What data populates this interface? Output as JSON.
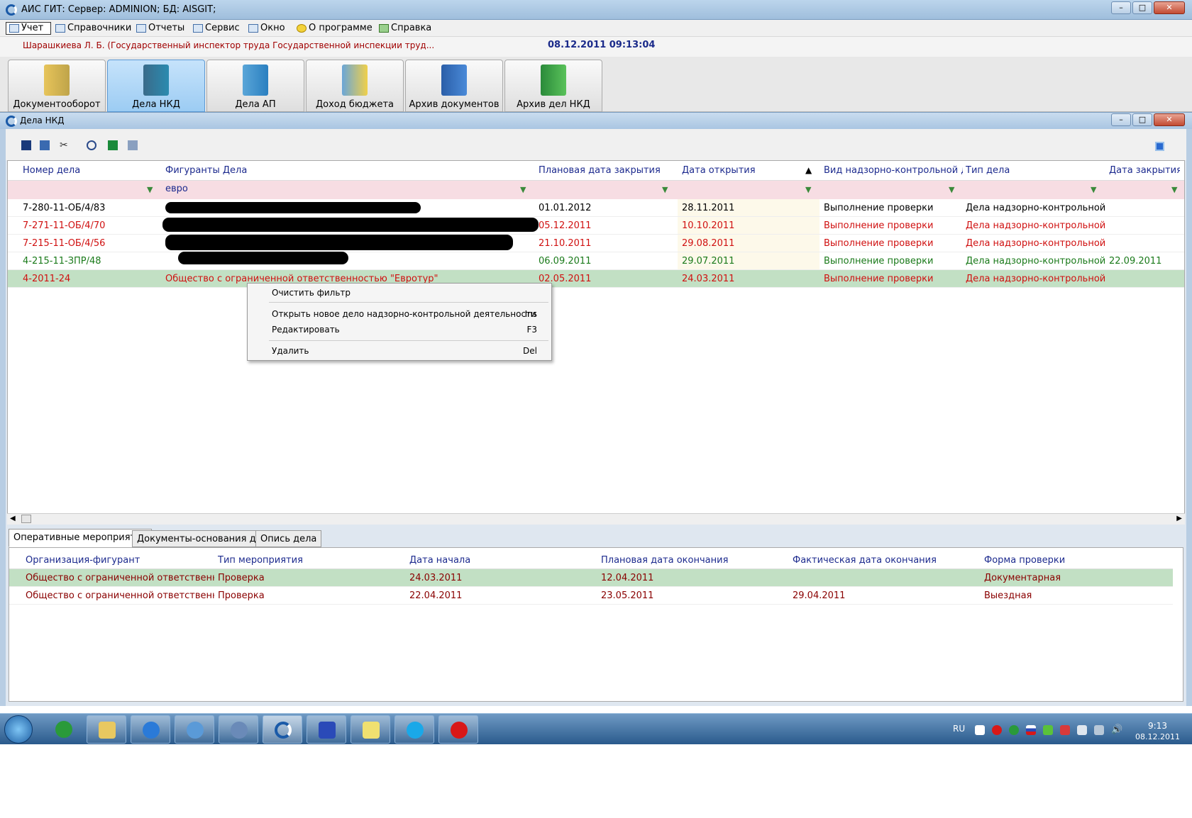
{
  "app": {
    "title": "АИС ГИТ:  Сервер: ADMINION;   БД: AISGIT;"
  },
  "menu": [
    {
      "label": "Учет"
    },
    {
      "label": "Справочники"
    },
    {
      "label": "Отчеты"
    },
    {
      "label": "Сервис"
    },
    {
      "label": "Окно"
    },
    {
      "label": "О программе"
    },
    {
      "label": "Справка"
    }
  ],
  "user": {
    "name": "Шарашкиева Л. Б. (Государственный инспектор труда Государственной инспекции труд...",
    "datetime": "08.12.2011  09:13:04"
  },
  "modules": [
    {
      "label": "Документооборот"
    },
    {
      "label": "Дела НКД"
    },
    {
      "label": "Дела АП"
    },
    {
      "label": "Доход бюджета"
    },
    {
      "label": "Архив документов"
    },
    {
      "label": "Архив дел НКД"
    }
  ],
  "child": {
    "title": "Дела НКД"
  },
  "grid": {
    "columns": [
      "Номер дела",
      "Фигуранты Дела",
      "Плановая дата закрытия",
      "Дата открытия",
      "Вид надзорно-контрольной деятельности",
      "Тип дела",
      "Дата закрытия"
    ],
    "filter": {
      "figuranty": "евро"
    },
    "rows": [
      {
        "num": "7-280-11-ОБ/4/83",
        "fig": "",
        "plan": "01.01.2012",
        "open": "28.11.2011",
        "vid": "Выполнение проверки",
        "tip": "Дела надзорно-контрольной де",
        "close": ""
      },
      {
        "num": "7-271-11-ОБ/4/70",
        "fig": "",
        "plan": "05.12.2011",
        "open": "10.10.2011",
        "vid": "Выполнение проверки",
        "tip": "Дела надзорно-контрольной де",
        "close": ""
      },
      {
        "num": "7-215-11-ОБ/4/56",
        "fig": "",
        "plan": "21.10.2011",
        "open": "29.08.2011",
        "vid": "Выполнение проверки",
        "tip": "Дела надзорно-контрольной де",
        "close": ""
      },
      {
        "num": "4-215-11-ЗПР/48",
        "fig": "",
        "plan": "06.09.2011",
        "open": "29.07.2011",
        "vid": "Выполнение проверки",
        "tip": "Дела надзорно-контрольной де",
        "close": "22.09.2011"
      },
      {
        "num": "4-2011-24",
        "fig": "Общество с ограниченной ответственностью \"Евротур\"",
        "plan": "02.05.2011",
        "open": "24.03.2011",
        "vid": "Выполнение проверки",
        "tip": "Дела надзорно-контрольной де",
        "close": ""
      }
    ]
  },
  "context_menu": {
    "items": [
      {
        "label": "Очистить фильтр",
        "key": ""
      },
      {
        "label": "Открыть новое дело надзорно-контрольной деятельности",
        "key": "Ins"
      },
      {
        "label": "Редактировать",
        "key": "F3"
      },
      {
        "label": "Удалить",
        "key": "Del"
      }
    ]
  },
  "tabs": [
    {
      "label": "Оперативные мероприятия"
    },
    {
      "label": "Документы-основания дела"
    },
    {
      "label": "Опись дела"
    }
  ],
  "bottom_grid": {
    "columns": [
      "Организация-фигурант",
      "Тип мероприятия",
      "Дата начала",
      "Плановая дата окончания",
      "Фактическая дата окончания",
      "Форма проверки"
    ],
    "rows": [
      {
        "org": "Общество с ограниченной ответственность",
        "type": "Проверка",
        "start": "24.03.2011",
        "plan": "12.04.2011",
        "fact": "",
        "form": "Документарная"
      },
      {
        "org": "Общество с ограниченной ответственность",
        "type": "Проверка",
        "start": "22.04.2011",
        "plan": "23.05.2011",
        "fact": "29.04.2011",
        "form": "Выездная"
      }
    ]
  },
  "taskbar": {
    "lang": "RU",
    "time": "9:13",
    "date": "08.12.2011"
  },
  "colors": {
    "accent": "#1c2a8e",
    "red": "#d01010",
    "green": "#1a7a1a",
    "selected": "#c2e0c4",
    "filter": "#f7dde3"
  }
}
